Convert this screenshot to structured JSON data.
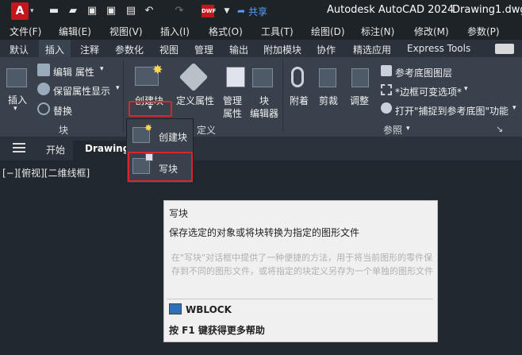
{
  "titlebar": {
    "logo": "A",
    "share": "共享",
    "app_title": "Autodesk AutoCAD 2024",
    "doc_title": "Drawing1.dwg",
    "icons": [
      "new-icon",
      "open-icon",
      "save-icon",
      "saveas-icon",
      "print-icon",
      "undo-icon",
      "redo-icon",
      "dwf-icon"
    ]
  },
  "menu": [
    "文件(F)",
    "编辑(E)",
    "视图(V)",
    "插入(I)",
    "格式(O)",
    "工具(T)",
    "绘图(D)",
    "标注(N)",
    "修改(M)",
    "参数(P)"
  ],
  "tabs": [
    "默认",
    "插入",
    "注释",
    "参数化",
    "视图",
    "管理",
    "输出",
    "附加模块",
    "协作",
    "精选应用",
    "Express Tools"
  ],
  "ribbon": {
    "block_panel": {
      "title": "块",
      "insert_label": "插入",
      "edit_attr": "编辑 属性",
      "keep_attr": "保留属性显示",
      "replace": "替换"
    },
    "block_def_panel": {
      "title": "定义",
      "create_block": "创建块",
      "define_attr": "定义属性",
      "manage_attr_1": "管理",
      "manage_attr_2": "属性",
      "block_editor_1": "块",
      "block_editor_2": "编辑器"
    },
    "reference_panel": {
      "title": "参照",
      "attach": "附着",
      "clip": "剪裁",
      "adjust": "调整",
      "underlay_layers": "参考底图图层",
      "frame_variable": "*边框可变选项*",
      "snap_underlay": "打开\"捕捉到参考底图\"功能"
    }
  },
  "dropdown": {
    "create_block": "创建块",
    "write_block": "写块"
  },
  "filetabs": {
    "start": "开始",
    "drawing": "Drawing1"
  },
  "viewport": {
    "label": "[−][俯视][二维线框]"
  },
  "tooltip": {
    "title": "写块",
    "desc": "保存选定的对象或将块转换为指定的图形文件",
    "long": "在\"写块\"对话框中提供了一种便捷的方法，用于将当前图形的零件保存到不同的图形文件，或将指定的块定义另存为一个单独的图形文件",
    "command": "WBLOCK",
    "help": "按 F1 键获得更多帮助"
  }
}
